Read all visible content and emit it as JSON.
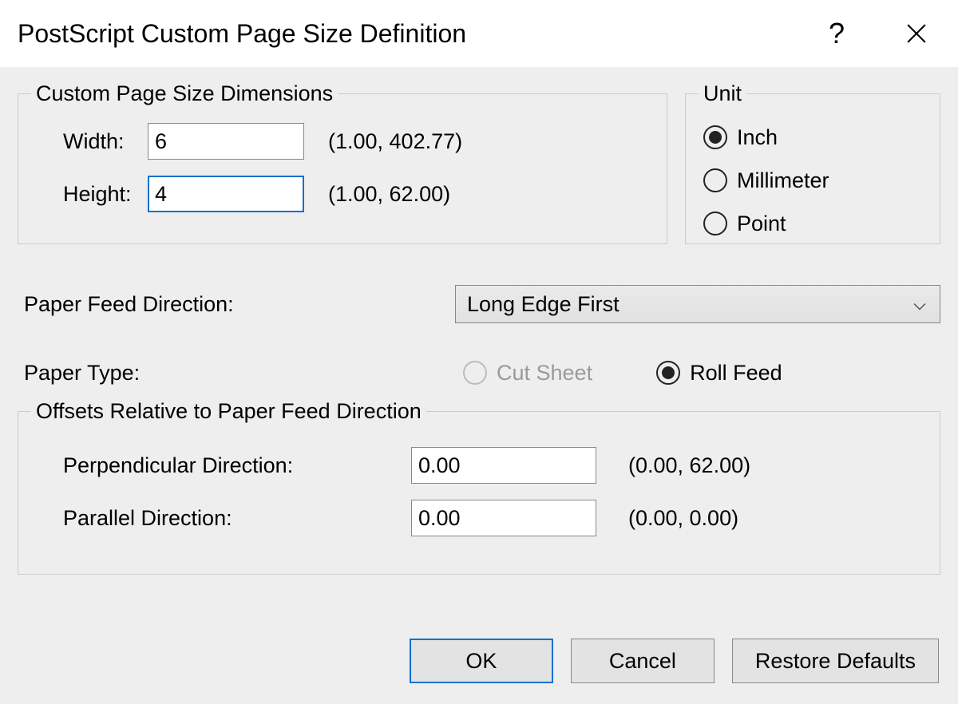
{
  "title": "PostScript Custom Page Size Definition",
  "groups": {
    "dimensions": {
      "legend": "Custom Page Size Dimensions",
      "width": {
        "label": "Width:",
        "value": "6",
        "range": "(1.00, 402.77)"
      },
      "height": {
        "label": "Height:",
        "value": "4",
        "range": "(1.00, 62.00)"
      }
    },
    "unit": {
      "legend": "Unit",
      "options": [
        {
          "label": "Inch",
          "checked": true
        },
        {
          "label": "Millimeter",
          "checked": false
        },
        {
          "label": "Point",
          "checked": false
        }
      ]
    },
    "offsets": {
      "legend": "Offsets Relative to Paper Feed Direction",
      "perpendicular": {
        "label": "Perpendicular Direction:",
        "value": "0.00",
        "range": "(0.00, 62.00)"
      },
      "parallel": {
        "label": "Parallel Direction:",
        "value": "0.00",
        "range": "(0.00, 0.00)"
      }
    }
  },
  "paper_feed_direction": {
    "label": "Paper Feed Direction:",
    "value": "Long Edge First"
  },
  "paper_type": {
    "label": "Paper Type:",
    "options": [
      {
        "label": "Cut Sheet",
        "checked": false,
        "enabled": false
      },
      {
        "label": "Roll Feed",
        "checked": true,
        "enabled": true
      }
    ]
  },
  "buttons": {
    "ok": "OK",
    "cancel": "Cancel",
    "restore": "Restore Defaults"
  }
}
